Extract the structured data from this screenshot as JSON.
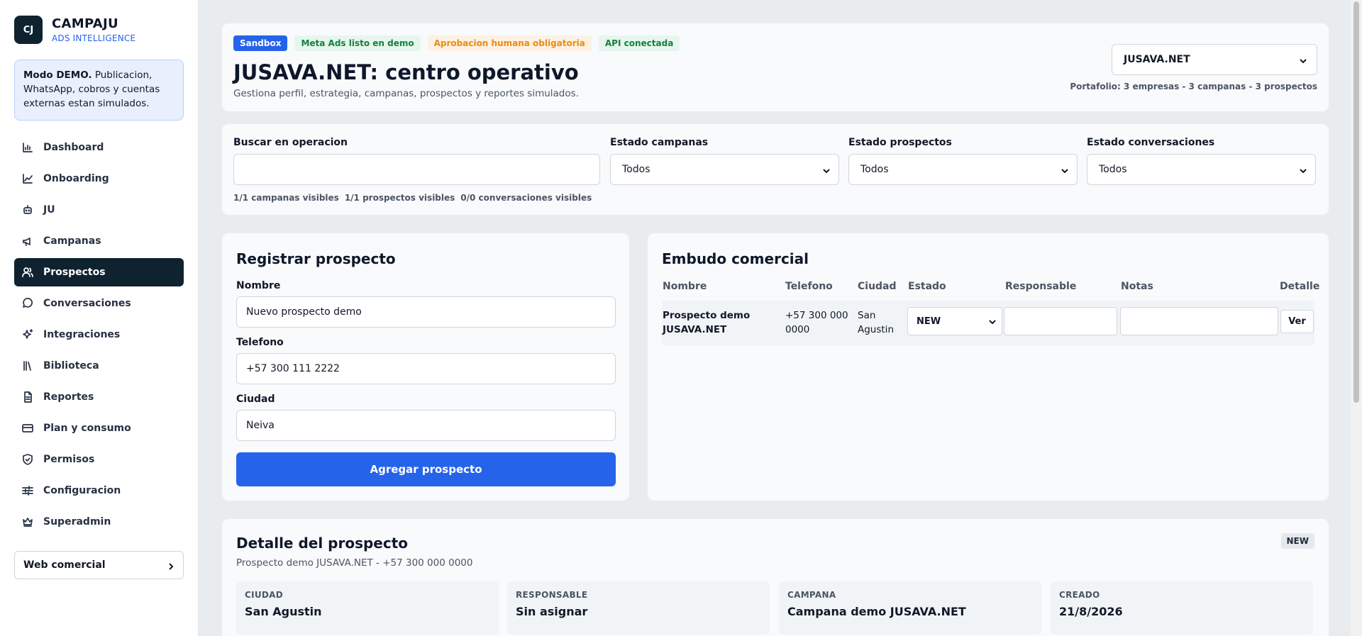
{
  "brand": {
    "logo": "CJ",
    "name": "CAMPAJU",
    "subtitle": "ADS INTELLIGENCE"
  },
  "demo_notice": {
    "bold": "Modo DEMO.",
    "text": " Publicacion, WhatsApp, cobros y cuentas externas estan simulados."
  },
  "nav": {
    "items": [
      {
        "label": "Dashboard",
        "icon": "bar-chart-icon"
      },
      {
        "label": "Onboarding",
        "icon": "line-chart-icon"
      },
      {
        "label": "JU",
        "icon": "bot-icon"
      },
      {
        "label": "Campanas",
        "icon": "megaphone-icon"
      },
      {
        "label": "Prospectos",
        "icon": "users-icon",
        "active": true
      },
      {
        "label": "Conversaciones",
        "icon": "message-icon"
      },
      {
        "label": "Integraciones",
        "icon": "sparkles-icon"
      },
      {
        "label": "Biblioteca",
        "icon": "library-icon"
      },
      {
        "label": "Reportes",
        "icon": "file-icon"
      },
      {
        "label": "Plan y consumo",
        "icon": "credit-card-icon"
      },
      {
        "label": "Permisos",
        "icon": "shield-icon"
      },
      {
        "label": "Configuracion",
        "icon": "sliders-icon"
      },
      {
        "label": "Superadmin",
        "icon": "crown-icon"
      }
    ],
    "web_button": "Web comercial"
  },
  "header": {
    "badges": [
      "Sandbox",
      "Meta Ads listo en demo",
      "Aprobacion humana obligatoria",
      "API conectada"
    ],
    "title": "JUSAVA.NET: centro operativo",
    "subtitle": "Gestiona perfil, estrategia, campanas, prospectos y reportes simulados.",
    "company_select": "JUSAVA.NET",
    "portfolio": "Portafolio: 3 empresas - 3 campanas - 3 prospectos"
  },
  "filters": {
    "search_label": "Buscar en operacion",
    "search_value": "",
    "campaign_label": "Estado campanas",
    "campaign_value": "Todos",
    "prospect_label": "Estado prospectos",
    "prospect_value": "Todos",
    "conversation_label": "Estado conversaciones",
    "conversation_value": "Todos",
    "counts": [
      "1/1 campanas visibles",
      "1/1 prospectos visibles",
      "0/0 conversaciones visibles"
    ]
  },
  "register": {
    "title": "Registrar prospecto",
    "name_label": "Nombre",
    "name_value": "Nuevo prospecto demo",
    "phone_label": "Telefono",
    "phone_value": "+57 300 111 2222",
    "city_label": "Ciudad",
    "city_value": "Neiva",
    "submit": "Agregar prospecto"
  },
  "funnel": {
    "title": "Embudo comercial",
    "columns": [
      "Nombre",
      "Telefono",
      "Ciudad",
      "Estado",
      "Responsable",
      "Notas",
      "Detalle"
    ],
    "rows": [
      {
        "name": "Prospecto demo JUSAVA.NET",
        "phone": "+57 300 000 0000",
        "city": "San Agustin",
        "status": "NEW",
        "responsible": "",
        "notes": "",
        "action": "Ver"
      }
    ]
  },
  "detail": {
    "title": "Detalle del prospecto",
    "subtitle": "Prospecto demo JUSAVA.NET - +57 300 000 0000",
    "badge": "NEW",
    "tiles": [
      {
        "label": "CIUDAD",
        "value": "San Agustin"
      },
      {
        "label": "RESPONSABLE",
        "value": "Sin asignar"
      },
      {
        "label": "CAMPANA",
        "value": "Campana demo JUSAVA.NET"
      },
      {
        "label": "CREADO",
        "value": "21/8/2026"
      }
    ]
  },
  "colors": {
    "accent": "#2563eb",
    "dark": "#0f2230",
    "success": "#15803d",
    "warning": "#ea8c14"
  }
}
